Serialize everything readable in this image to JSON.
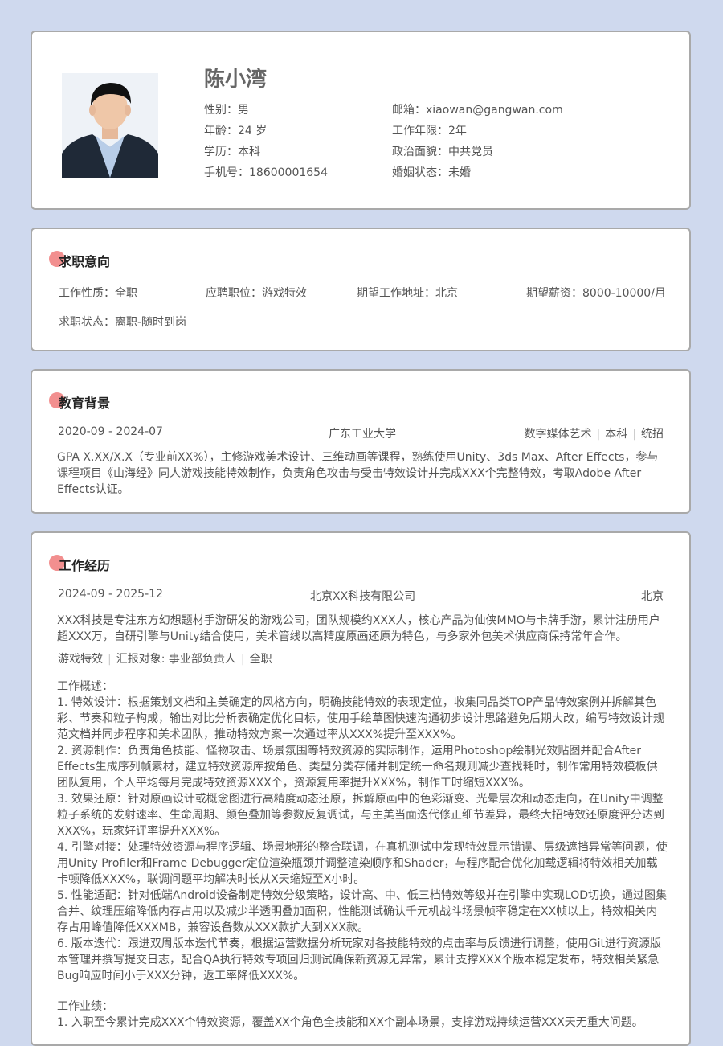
{
  "profile": {
    "name": "陈小湾",
    "gender_label": "性别：",
    "gender": "男",
    "email_label": "邮箱：",
    "email": "xiaowan@gangwan.com",
    "age_label": "年龄：",
    "age": "24 岁",
    "years_label": "工作年限：",
    "years": "2年",
    "edu_label": "学历：",
    "edu": "本科",
    "politics_label": "政治面貌：",
    "politics": "中共党员",
    "phone_label": "手机号：",
    "phone": "18600001654",
    "marital_label": "婚姻状态：",
    "marital": "未婚"
  },
  "intent": {
    "title": "求职意向",
    "type_label": "工作性质：",
    "type": "全职",
    "position_label": "应聘职位：",
    "position": "游戏特效",
    "location_label": "期望工作地址：",
    "location": "北京",
    "salary_label": "期望薪资：",
    "salary": "8000-10000/月",
    "status_label": "求职状态：",
    "status": "离职-随时到岗"
  },
  "education": {
    "title": "教育背景",
    "period": "2020-09 - 2024-07",
    "school": "广东工业大学",
    "major": "数字媒体艺术",
    "degree": "本科",
    "mode": "统招",
    "desc": "GPA X.XX/X.X（专业前XX%），主修游戏美术设计、三维动画等课程，熟练使用Unity、3ds Max、After Effects，参与课程项目《山海经》同人游戏技能特效制作，负责角色攻击与受击特效设计并完成XXX个完整特效，考取Adobe After Effects认证。"
  },
  "work": {
    "title": "工作经历",
    "period": "2024-09 - 2025-12",
    "company": "北京XX科技有限公司",
    "city": "北京",
    "company_desc": "XXX科技是专注东方幻想题材手游研发的游戏公司，团队规模约XXX人，核心产品为仙侠MMO与卡牌手游，累计注册用户超XXX万，自研引擎与Unity结合使用，美术管线以高精度原画还原为特色，与多家外包美术供应商保持常年合作。",
    "role": "游戏特效",
    "report": "汇报对象: 事业部负责人",
    "worktype": "全职",
    "overview_label": "工作概述：",
    "items": [
      "1. 特效设计：根据策划文档和主美确定的风格方向，明确技能特效的表现定位，收集同品类TOP产品特效案例并拆解其色彩、节奏和粒子构成，输出对比分析表确定优化目标，使用手绘草图快速沟通初步设计思路避免后期大改，编写特效设计规范文档并同步程序和美术团队，推动特效方案一次通过率从XXX%提升至XXX%。",
      "2. 资源制作：负责角色技能、怪物攻击、场景氛围等特效资源的实际制作，运用Photoshop绘制光效贴图并配合After Effects生成序列帧素材，建立特效资源库按角色、类型分类存储并制定统一命名规则减少查找耗时，制作常用特效模板供团队复用，个人平均每月完成特效资源XXX个，资源复用率提升XXX%，制作工时缩短XXX%。",
      "3. 效果还原：针对原画设计或概念图进行高精度动态还原，拆解原画中的色彩渐变、光晕层次和动态走向，在Unity中调整粒子系统的发射速率、生命周期、颜色叠加等参数反复调试，与主美当面迭代修正细节差异，最终大招特效还原度评分达到XXX%，玩家好评率提升XXX%。",
      "4. 引擎对接：处理特效资源与程序逻辑、场景地形的整合联调，在真机测试中发现特效显示错误、层级遮挡异常等问题，使用Unity Profiler和Frame Debugger定位渲染瓶颈并调整渲染顺序和Shader，与程序配合优化加载逻辑将特效相关加载卡顿降低XXX%，联调问题平均解决时长从X天缩短至X小时。",
      "5. 性能适配：针对低端Android设备制定特效分级策略，设计高、中、低三档特效等级并在引擎中实现LOD切换，通过图集合并、纹理压缩降低内存占用以及减少半透明叠加面积，性能测试确认千元机战斗场景帧率稳定在XX帧以上，特效相关内存占用峰值降低XXXMB，兼容设备数从XXX款扩大到XXX款。",
      "6. 版本迭代：跟进双周版本迭代节奏，根据运营数据分析玩家对各技能特效的点击率与反馈进行调整，使用Git进行资源版本管理并撰写提交日志，配合QA执行特效专项回归测试确保新资源无异常，累计支撑XXX个版本稳定发布，特效相关紧急Bug响应时间小于XXX分钟，返工率降低XXX%。"
    ],
    "achievement_label": "工作业绩：",
    "achievement_1": "1. 入职至今累计完成XXX个特效资源，覆盖XX个角色全技能和XX个副本场景，支撑游戏持续运营XXX天无重大问题。"
  }
}
